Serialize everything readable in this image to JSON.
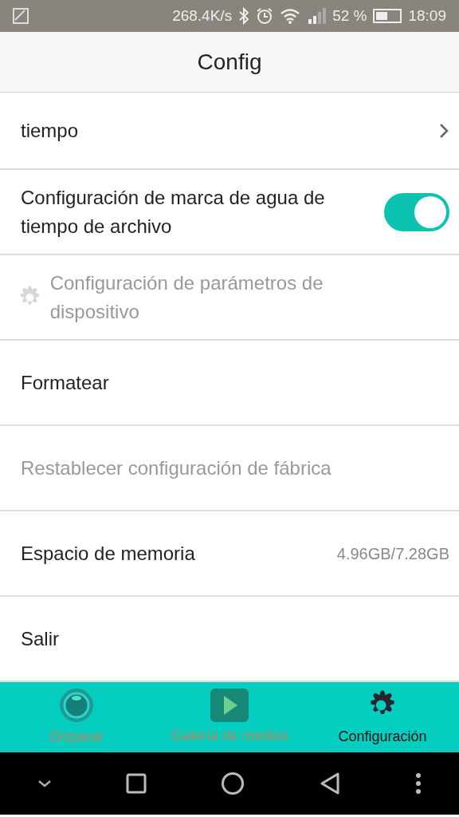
{
  "status_bar": {
    "speed": "268.4K/s",
    "battery_percent": "52 %",
    "time": "18:09"
  },
  "header": {
    "title": "Config"
  },
  "items": [
    {
      "kind": "nav",
      "label": "tiempo",
      "disabled": false
    },
    {
      "kind": "toggle",
      "label": "Configuración de marca de agua de tiempo de archivo",
      "disabled": false,
      "on": true
    },
    {
      "kind": "section",
      "label": "Configuración de parámetros de dispositivo",
      "disabled": true
    },
    {
      "kind": "plain",
      "label": "Formatear",
      "disabled": false
    },
    {
      "kind": "plain",
      "label": "Restablecer configuración de fábrica",
      "disabled": true
    },
    {
      "kind": "info",
      "label": "Espacio de memoria",
      "value": "4.96GB/7.28GB",
      "disabled": false
    },
    {
      "kind": "plain",
      "label": "Salir",
      "disabled": false
    }
  ],
  "tabs": [
    {
      "kind": "shoot",
      "label": "Disparar",
      "selected": false
    },
    {
      "kind": "gallery",
      "label": "Galería de medios",
      "selected": false
    },
    {
      "kind": "settings",
      "label": "Configuración",
      "selected": true
    }
  ]
}
